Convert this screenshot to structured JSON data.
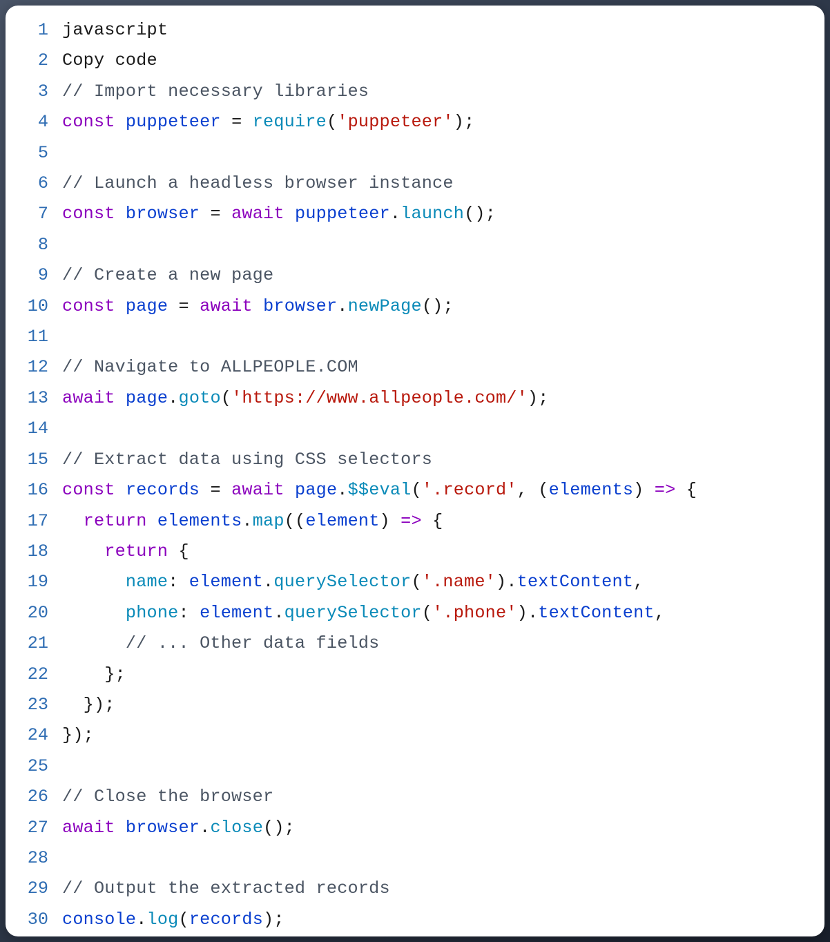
{
  "code": {
    "language": "javascript",
    "lines": [
      {
        "n": 1,
        "tokens": [
          {
            "cls": "tk-plain",
            "t": "javascript"
          }
        ]
      },
      {
        "n": 2,
        "tokens": [
          {
            "cls": "tk-plain",
            "t": "Copy code"
          }
        ]
      },
      {
        "n": 3,
        "tokens": [
          {
            "cls": "tk-comment",
            "t": "// Import necessary libraries"
          }
        ]
      },
      {
        "n": 4,
        "tokens": [
          {
            "cls": "tk-kw",
            "t": "const"
          },
          {
            "cls": "tk-plain",
            "t": " "
          },
          {
            "cls": "tk-def",
            "t": "puppeteer"
          },
          {
            "cls": "tk-plain",
            "t": " "
          },
          {
            "cls": "tk-punct",
            "t": "="
          },
          {
            "cls": "tk-plain",
            "t": " "
          },
          {
            "cls": "tk-prop",
            "t": "require"
          },
          {
            "cls": "tk-punct",
            "t": "("
          },
          {
            "cls": "tk-str",
            "t": "'puppeteer'"
          },
          {
            "cls": "tk-punct",
            "t": ");"
          }
        ]
      },
      {
        "n": 5,
        "tokens": []
      },
      {
        "n": 6,
        "tokens": [
          {
            "cls": "tk-comment",
            "t": "// Launch a headless browser instance"
          }
        ]
      },
      {
        "n": 7,
        "tokens": [
          {
            "cls": "tk-kw",
            "t": "const"
          },
          {
            "cls": "tk-plain",
            "t": " "
          },
          {
            "cls": "tk-def",
            "t": "browser"
          },
          {
            "cls": "tk-plain",
            "t": " "
          },
          {
            "cls": "tk-punct",
            "t": "="
          },
          {
            "cls": "tk-plain",
            "t": " "
          },
          {
            "cls": "tk-kw",
            "t": "await"
          },
          {
            "cls": "tk-plain",
            "t": " "
          },
          {
            "cls": "tk-def",
            "t": "puppeteer"
          },
          {
            "cls": "tk-punct",
            "t": "."
          },
          {
            "cls": "tk-prop",
            "t": "launch"
          },
          {
            "cls": "tk-punct",
            "t": "();"
          }
        ]
      },
      {
        "n": 8,
        "tokens": []
      },
      {
        "n": 9,
        "tokens": [
          {
            "cls": "tk-comment",
            "t": "// Create a new page"
          }
        ]
      },
      {
        "n": 10,
        "tokens": [
          {
            "cls": "tk-kw",
            "t": "const"
          },
          {
            "cls": "tk-plain",
            "t": " "
          },
          {
            "cls": "tk-def",
            "t": "page"
          },
          {
            "cls": "tk-plain",
            "t": " "
          },
          {
            "cls": "tk-punct",
            "t": "="
          },
          {
            "cls": "tk-plain",
            "t": " "
          },
          {
            "cls": "tk-kw",
            "t": "await"
          },
          {
            "cls": "tk-plain",
            "t": " "
          },
          {
            "cls": "tk-def",
            "t": "browser"
          },
          {
            "cls": "tk-punct",
            "t": "."
          },
          {
            "cls": "tk-prop",
            "t": "newPage"
          },
          {
            "cls": "tk-punct",
            "t": "();"
          }
        ]
      },
      {
        "n": 11,
        "tokens": []
      },
      {
        "n": 12,
        "tokens": [
          {
            "cls": "tk-comment",
            "t": "// Navigate to ALLPEOPLE.COM"
          }
        ]
      },
      {
        "n": 13,
        "tokens": [
          {
            "cls": "tk-kw",
            "t": "await"
          },
          {
            "cls": "tk-plain",
            "t": " "
          },
          {
            "cls": "tk-def",
            "t": "page"
          },
          {
            "cls": "tk-punct",
            "t": "."
          },
          {
            "cls": "tk-prop",
            "t": "goto"
          },
          {
            "cls": "tk-punct",
            "t": "("
          },
          {
            "cls": "tk-str",
            "t": "'https://www.allpeople.com/'"
          },
          {
            "cls": "tk-punct",
            "t": ");"
          }
        ]
      },
      {
        "n": 14,
        "tokens": []
      },
      {
        "n": 15,
        "tokens": [
          {
            "cls": "tk-comment",
            "t": "// Extract data using CSS selectors"
          }
        ]
      },
      {
        "n": 16,
        "tokens": [
          {
            "cls": "tk-kw",
            "t": "const"
          },
          {
            "cls": "tk-plain",
            "t": " "
          },
          {
            "cls": "tk-def",
            "t": "records"
          },
          {
            "cls": "tk-plain",
            "t": " "
          },
          {
            "cls": "tk-punct",
            "t": "="
          },
          {
            "cls": "tk-plain",
            "t": " "
          },
          {
            "cls": "tk-kw",
            "t": "await"
          },
          {
            "cls": "tk-plain",
            "t": " "
          },
          {
            "cls": "tk-def",
            "t": "page"
          },
          {
            "cls": "tk-punct",
            "t": "."
          },
          {
            "cls": "tk-prop",
            "t": "$$eval"
          },
          {
            "cls": "tk-punct",
            "t": "("
          },
          {
            "cls": "tk-str",
            "t": "'.record'"
          },
          {
            "cls": "tk-punct",
            "t": ", ("
          },
          {
            "cls": "tk-def",
            "t": "elements"
          },
          {
            "cls": "tk-punct",
            "t": ") "
          },
          {
            "cls": "tk-kw",
            "t": "=>"
          },
          {
            "cls": "tk-punct",
            "t": " {"
          }
        ]
      },
      {
        "n": 17,
        "tokens": [
          {
            "cls": "tk-plain",
            "t": "  "
          },
          {
            "cls": "tk-kw",
            "t": "return"
          },
          {
            "cls": "tk-plain",
            "t": " "
          },
          {
            "cls": "tk-def",
            "t": "elements"
          },
          {
            "cls": "tk-punct",
            "t": "."
          },
          {
            "cls": "tk-prop",
            "t": "map"
          },
          {
            "cls": "tk-punct",
            "t": "(("
          },
          {
            "cls": "tk-def",
            "t": "element"
          },
          {
            "cls": "tk-punct",
            "t": ") "
          },
          {
            "cls": "tk-kw",
            "t": "=>"
          },
          {
            "cls": "tk-punct",
            "t": " {"
          }
        ]
      },
      {
        "n": 18,
        "tokens": [
          {
            "cls": "tk-plain",
            "t": "    "
          },
          {
            "cls": "tk-kw",
            "t": "return"
          },
          {
            "cls": "tk-punct",
            "t": " {"
          }
        ]
      },
      {
        "n": 19,
        "tokens": [
          {
            "cls": "tk-plain",
            "t": "      "
          },
          {
            "cls": "tk-prop",
            "t": "name"
          },
          {
            "cls": "tk-punct",
            "t": ": "
          },
          {
            "cls": "tk-def",
            "t": "element"
          },
          {
            "cls": "tk-punct",
            "t": "."
          },
          {
            "cls": "tk-prop",
            "t": "querySelector"
          },
          {
            "cls": "tk-punct",
            "t": "("
          },
          {
            "cls": "tk-str",
            "t": "'.name'"
          },
          {
            "cls": "tk-punct",
            "t": ")."
          },
          {
            "cls": "tk-def",
            "t": "textContent"
          },
          {
            "cls": "tk-punct",
            "t": ","
          }
        ]
      },
      {
        "n": 20,
        "tokens": [
          {
            "cls": "tk-plain",
            "t": "      "
          },
          {
            "cls": "tk-prop",
            "t": "phone"
          },
          {
            "cls": "tk-punct",
            "t": ": "
          },
          {
            "cls": "tk-def",
            "t": "element"
          },
          {
            "cls": "tk-punct",
            "t": "."
          },
          {
            "cls": "tk-prop",
            "t": "querySelector"
          },
          {
            "cls": "tk-punct",
            "t": "("
          },
          {
            "cls": "tk-str",
            "t": "'.phone'"
          },
          {
            "cls": "tk-punct",
            "t": ")."
          },
          {
            "cls": "tk-def",
            "t": "textContent"
          },
          {
            "cls": "tk-punct",
            "t": ","
          }
        ]
      },
      {
        "n": 21,
        "tokens": [
          {
            "cls": "tk-plain",
            "t": "      "
          },
          {
            "cls": "tk-comment",
            "t": "// ... Other data fields"
          }
        ]
      },
      {
        "n": 22,
        "tokens": [
          {
            "cls": "tk-plain",
            "t": "    "
          },
          {
            "cls": "tk-punct",
            "t": "};"
          }
        ]
      },
      {
        "n": 23,
        "tokens": [
          {
            "cls": "tk-plain",
            "t": "  "
          },
          {
            "cls": "tk-punct",
            "t": "});"
          }
        ]
      },
      {
        "n": 24,
        "tokens": [
          {
            "cls": "tk-punct",
            "t": "});"
          }
        ]
      },
      {
        "n": 25,
        "tokens": []
      },
      {
        "n": 26,
        "tokens": [
          {
            "cls": "tk-comment",
            "t": "// Close the browser"
          }
        ]
      },
      {
        "n": 27,
        "tokens": [
          {
            "cls": "tk-kw",
            "t": "await"
          },
          {
            "cls": "tk-plain",
            "t": " "
          },
          {
            "cls": "tk-def",
            "t": "browser"
          },
          {
            "cls": "tk-punct",
            "t": "."
          },
          {
            "cls": "tk-prop",
            "t": "close"
          },
          {
            "cls": "tk-punct",
            "t": "();"
          }
        ]
      },
      {
        "n": 28,
        "tokens": []
      },
      {
        "n": 29,
        "tokens": [
          {
            "cls": "tk-comment",
            "t": "// Output the extracted records"
          }
        ]
      },
      {
        "n": 30,
        "tokens": [
          {
            "cls": "tk-def",
            "t": "console"
          },
          {
            "cls": "tk-punct",
            "t": "."
          },
          {
            "cls": "tk-prop",
            "t": "log"
          },
          {
            "cls": "tk-punct",
            "t": "("
          },
          {
            "cls": "tk-def",
            "t": "records"
          },
          {
            "cls": "tk-punct",
            "t": ");"
          }
        ]
      }
    ]
  }
}
